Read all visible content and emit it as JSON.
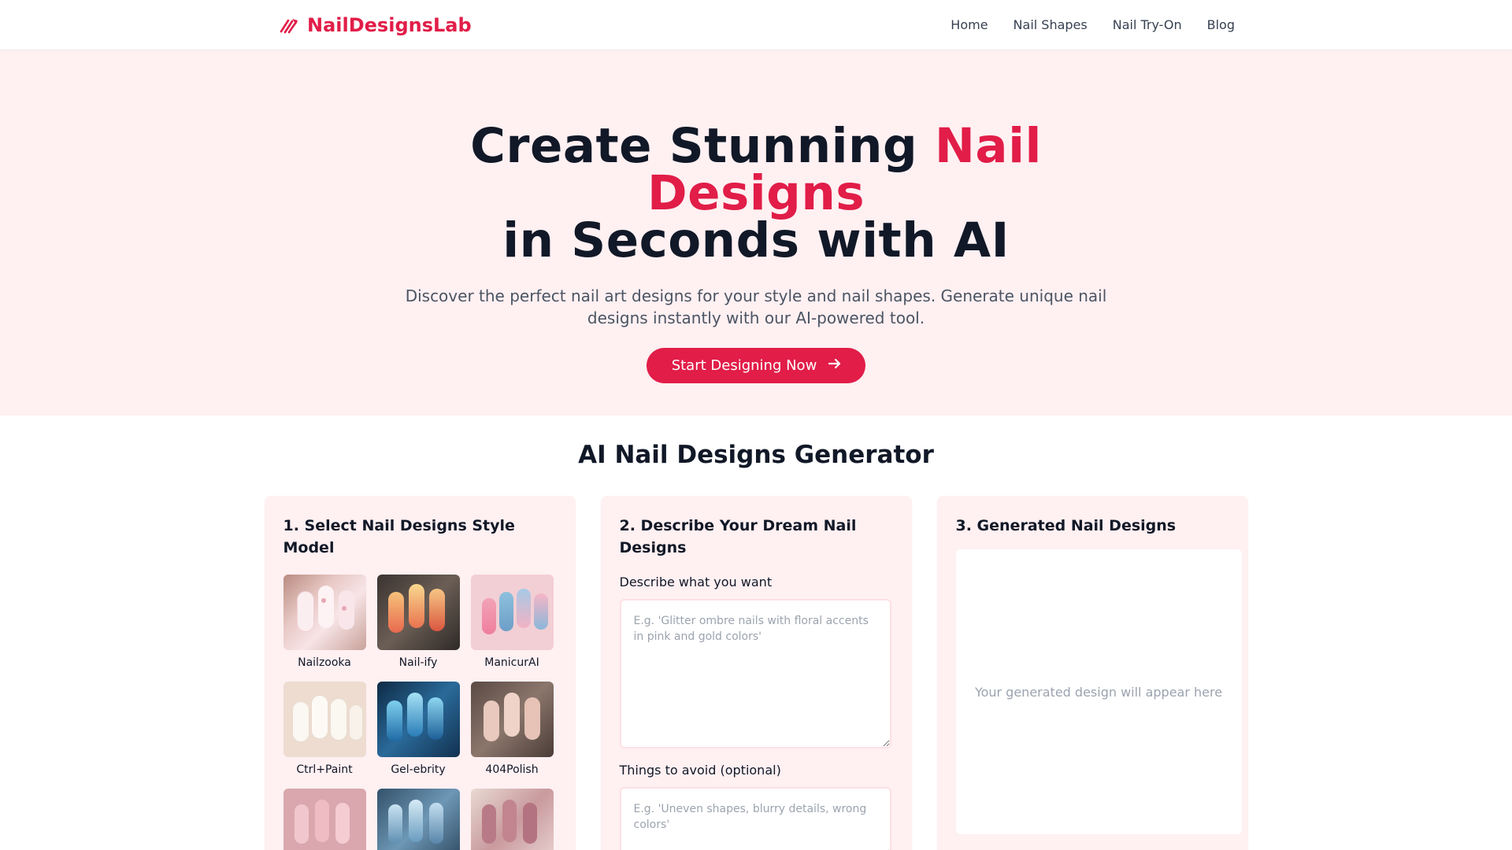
{
  "colors": {
    "accent": "#e11d48",
    "hero_bg": "#fff0f2",
    "card_bg": "#fff0f2"
  },
  "brand": {
    "name": "NailDesignsLab",
    "icon": "nail-polish-brush-icon"
  },
  "nav": {
    "items": [
      {
        "label": "Home"
      },
      {
        "label": "Nail Shapes"
      },
      {
        "label": "Nail Try-On"
      },
      {
        "label": "Blog"
      }
    ]
  },
  "hero": {
    "title_part1": "Create Stunning ",
    "title_accent": "Nail Designs",
    "title_part2": "in Seconds with AI",
    "subtitle": "Discover the perfect nail art designs for your style and nail shapes. Generate unique nail designs instantly with our AI-powered tool.",
    "cta_label": "Start Designing Now",
    "cta_icon": "arrow-right-icon"
  },
  "generator": {
    "title": "AI Nail Designs Generator",
    "step1": {
      "title": "1. Select Nail Designs Style Model",
      "models": [
        {
          "label": "Nailzooka"
        },
        {
          "label": "Nail-ify"
        },
        {
          "label": "ManicurAI"
        },
        {
          "label": "Ctrl+Paint"
        },
        {
          "label": "Gel-ebrity"
        },
        {
          "label": "404Polish"
        },
        {
          "label": ""
        },
        {
          "label": ""
        },
        {
          "label": ""
        }
      ]
    },
    "step2": {
      "title": "2. Describe Your Dream Nail Designs",
      "describe_label": "Describe what you want",
      "describe_placeholder": "E.g. 'Glitter ombre nails with floral accents in pink and gold colors'",
      "avoid_label": "Things to avoid (optional)",
      "avoid_placeholder": "E.g. 'Uneven shapes, blurry details, wrong colors'"
    },
    "step3": {
      "title": "3. Generated Nail Designs",
      "placeholder": "Your generated design will appear here"
    }
  }
}
